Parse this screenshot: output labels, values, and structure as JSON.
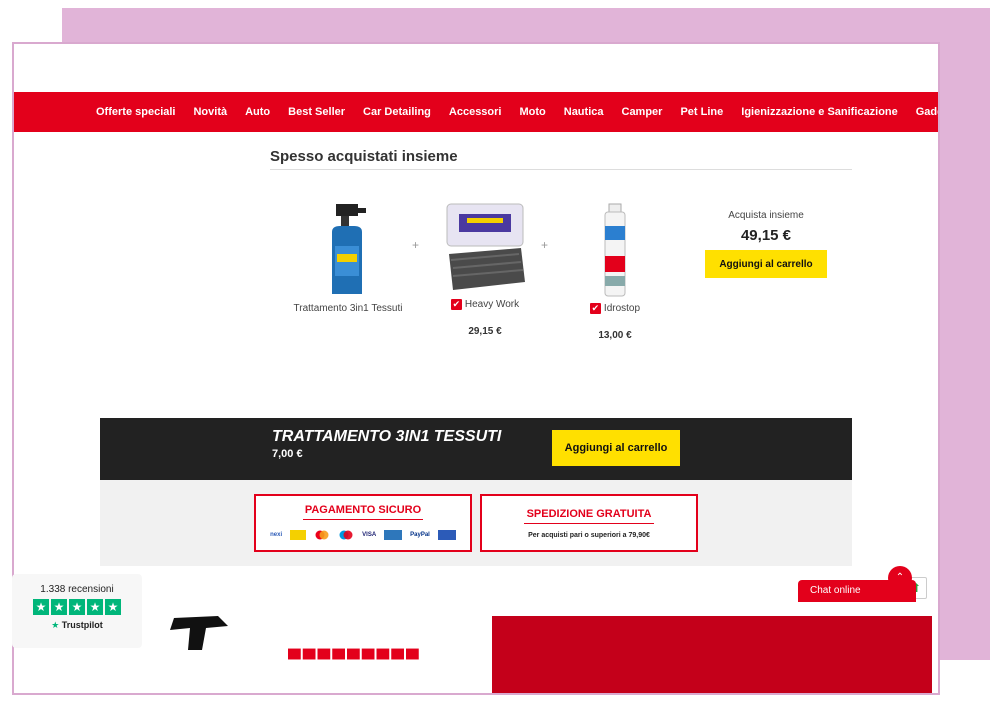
{
  "nav": {
    "items": [
      "Offerte speciali",
      "Novità",
      "Auto",
      "Best Seller",
      "Car Detailing",
      "Accessori",
      "Moto",
      "Nautica",
      "Camper",
      "Pet Line",
      "Igienizzazione e Sanificazione",
      "Gadget"
    ]
  },
  "bundle": {
    "title": "Spesso acquistati insieme",
    "plus": "+",
    "products": [
      {
        "name": "Trattamento 3in1 Tessuti",
        "price": "",
        "checked": false
      },
      {
        "name": "Heavy Work",
        "price": "29,15 €",
        "checked": true
      },
      {
        "name": "Idrostop",
        "price": "13,00 €",
        "checked": true
      }
    ],
    "together_label": "Acquista insieme",
    "together_price": "49,15 €",
    "add_button": "Aggiungi al carrello"
  },
  "sticky": {
    "product_name": "TRATTAMENTO 3IN1 TESSUTI",
    "price": "7,00 €",
    "add_button": "Aggiungi al carrello"
  },
  "info": {
    "payment_title": "PAGAMENTO SICURO",
    "payment_methods": [
      "nexi",
      "postepay",
      "mastercard",
      "maestro",
      "VISA",
      "AMEX",
      "PayPal",
      "bonifico"
    ],
    "shipping_title": "SPEDIZIONE GRATUITA",
    "shipping_sub": "Per acquisti pari o superiori a 79,90€"
  },
  "trustpilot": {
    "reviews": "1.338 recensioni",
    "brand": "Trustpilot"
  },
  "chat": {
    "label": "Chat online"
  },
  "colors": {
    "brand_red": "#e3001b",
    "yellow": "#ffe000",
    "dark": "#222222",
    "frame_pink": "#e1b4d8",
    "trust_green": "#00b67a"
  }
}
